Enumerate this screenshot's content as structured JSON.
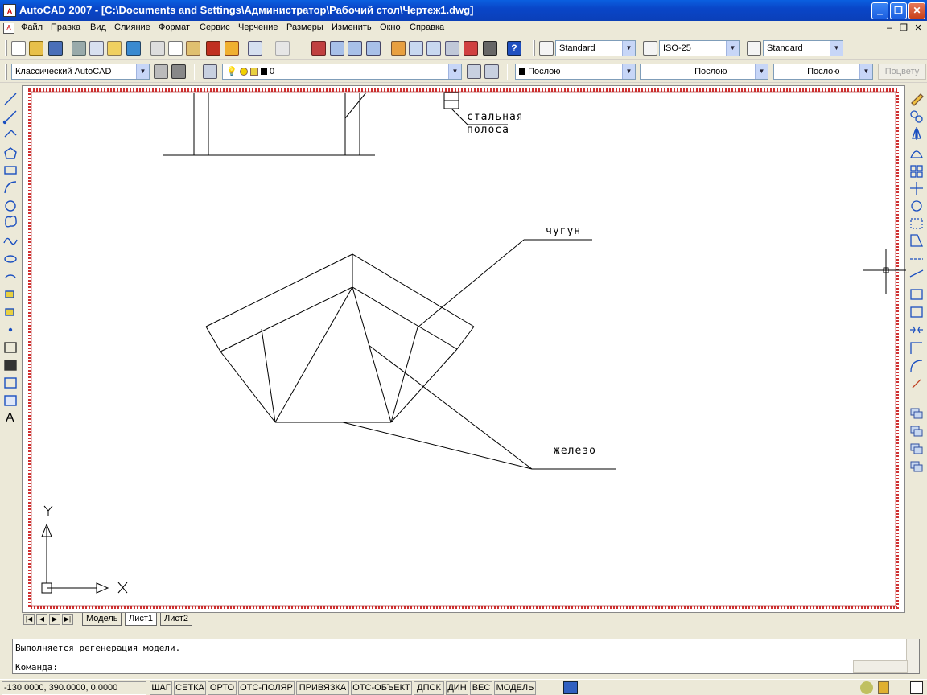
{
  "window": {
    "title": "AutoCAD 2007 - [C:\\Documents and Settings\\Администратор\\Рабочий стол\\Чертеж1.dwg]",
    "app_icon": "A",
    "controls": {
      "minimize": "_",
      "restore": "❐",
      "close": "✕"
    },
    "mdi_controls": {
      "minimize": "–",
      "restore": "❐",
      "close": "✕"
    }
  },
  "menu": {
    "items": [
      "Файл",
      "Правка",
      "Вид",
      "Слияние",
      "Формат",
      "Сервис",
      "Черчение",
      "Размеры",
      "Изменить",
      "Окно",
      "Справка"
    ]
  },
  "toolbar_styles": {
    "text_style": "Standard",
    "dim_style": "ISO-25",
    "table_style": "Standard"
  },
  "toolbar_properties": {
    "workspace": "Классический AutoCAD",
    "layer": "0",
    "color": "Послою",
    "linetype": "Послою",
    "lineweight": "Послою",
    "plot_style": "Поцвету"
  },
  "drawing": {
    "annotations": {
      "steel_strip_1": "стальная",
      "steel_strip_2": "полоса",
      "cast_iron": "чугун",
      "iron": "железо"
    },
    "ucs": {
      "x_label": "X",
      "y_label": "Y"
    }
  },
  "layout_tabs": {
    "nav": [
      "|◀",
      "◀",
      "▶",
      "▶|"
    ],
    "tabs": [
      "Модель",
      "Лист1",
      "Лист2"
    ],
    "active": "Лист1"
  },
  "command": {
    "history": "Выполняется регенерация модели.",
    "prompt": "Команда:"
  },
  "status": {
    "coordinates": "-130.0000, 390.0000, 0.0000",
    "buttons": [
      "ШАГ",
      "СЕТКА",
      "ОРТО",
      "ОТС-ПОЛЯР",
      "ПРИВЯЗКА",
      "ОТС-ОБЪЕКТ",
      "ДПСК",
      "ДИН",
      "ВЕС",
      "МОДЕЛЬ"
    ]
  },
  "colors": {
    "title_bar": "#0a46c8",
    "paper_border": "#d03030",
    "canvas": "#ffffff",
    "chrome": "#ece9d8"
  }
}
